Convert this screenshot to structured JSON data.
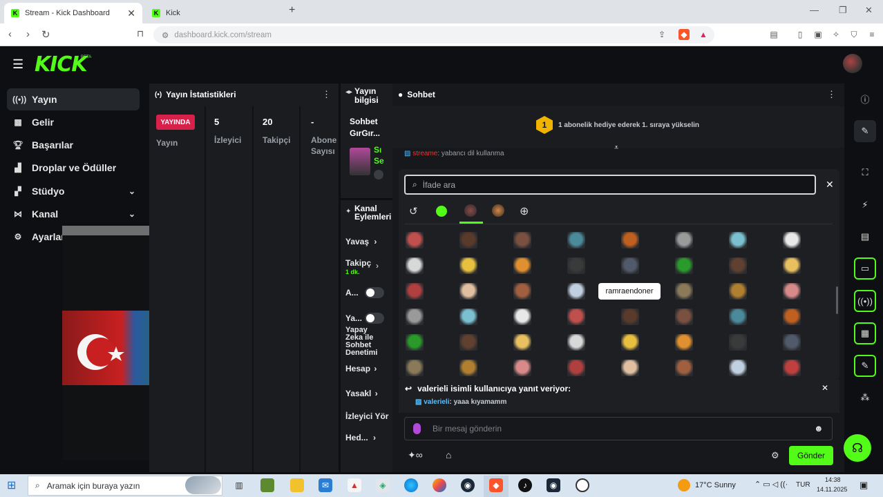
{
  "browser": {
    "tabs": [
      {
        "title": "Stream - Kick Dashboard",
        "active": true
      },
      {
        "title": "Kick",
        "active": false
      }
    ],
    "url": "dashboard.kick.com/stream"
  },
  "app": {
    "logo": "KICK",
    "logo_badge": "BETA",
    "accent": "#53fc18"
  },
  "sidebar": {
    "items": [
      {
        "label": "Yayın",
        "icon": "broadcast-icon"
      },
      {
        "label": "Gelir",
        "icon": "revenue-icon"
      },
      {
        "label": "Başarılar",
        "icon": "trophy-icon"
      },
      {
        "label": "Droplar ve Ödüller",
        "icon": "gift-icon"
      },
      {
        "label": "Stüdyo",
        "icon": "studio-icon"
      },
      {
        "label": "Kanal",
        "icon": "channel-icon"
      },
      {
        "label": "Ayarlar",
        "icon": "settings-icon"
      }
    ]
  },
  "stats_panel": {
    "title": "Yayın İstatistikleri",
    "live_badge": "YAYINDA",
    "live_label": "Yayın",
    "viewers_value": "5",
    "viewers_label": "İzleyici",
    "followers_value": "20",
    "followers_label": "Takipçi",
    "subs_value": "-",
    "subs_label_1": "Abone",
    "subs_label_2": "Sayısı"
  },
  "info_panel": {
    "title_1": "Yayın",
    "title_2": "bilgisi",
    "stream_title_1": "Sohbet",
    "stream_title_2": "GırGır...",
    "cat_1": "Sı",
    "cat_2": "Se"
  },
  "actions_panel": {
    "title_1": "Kanal",
    "title_2": "Eylemleri",
    "items": [
      {
        "label": "Yavaş"
      },
      {
        "label": "Takipç",
        "sub": "1 dk."
      },
      {
        "label": "A..."
      },
      {
        "label": "Ya..."
      },
      {
        "label": "Yapay Zeka ile Sohbet Denetimi"
      },
      {
        "label": "Hesap"
      },
      {
        "label": "Yasakl"
      },
      {
        "label": "İzleyici Yör"
      },
      {
        "label": "Hed..."
      }
    ]
  },
  "chat": {
    "title": "Sohbet",
    "gift_badge": "1",
    "gift_text": "1 abonelik hediye ederek 1. sıraya yükselin",
    "rule_user": "streame",
    "rule_text": ": yabancı dil kullanma",
    "search_placeholder": "İfade ara",
    "tooltip": "ramraendoner",
    "reply_header": "valerieli isimli kullanıcıya yanıt veriyor:",
    "reply_user": "valerieli",
    "reply_text": ": yaaa kıyamamm",
    "message_placeholder": "Bir mesaj gönderin",
    "send_label": "Gönder"
  },
  "taskbar": {
    "search_placeholder": "Aramak için buraya yazın",
    "weather": "17°C Sunny",
    "lang": "TUR",
    "time": "14:38",
    "date": "14.11.2025"
  }
}
